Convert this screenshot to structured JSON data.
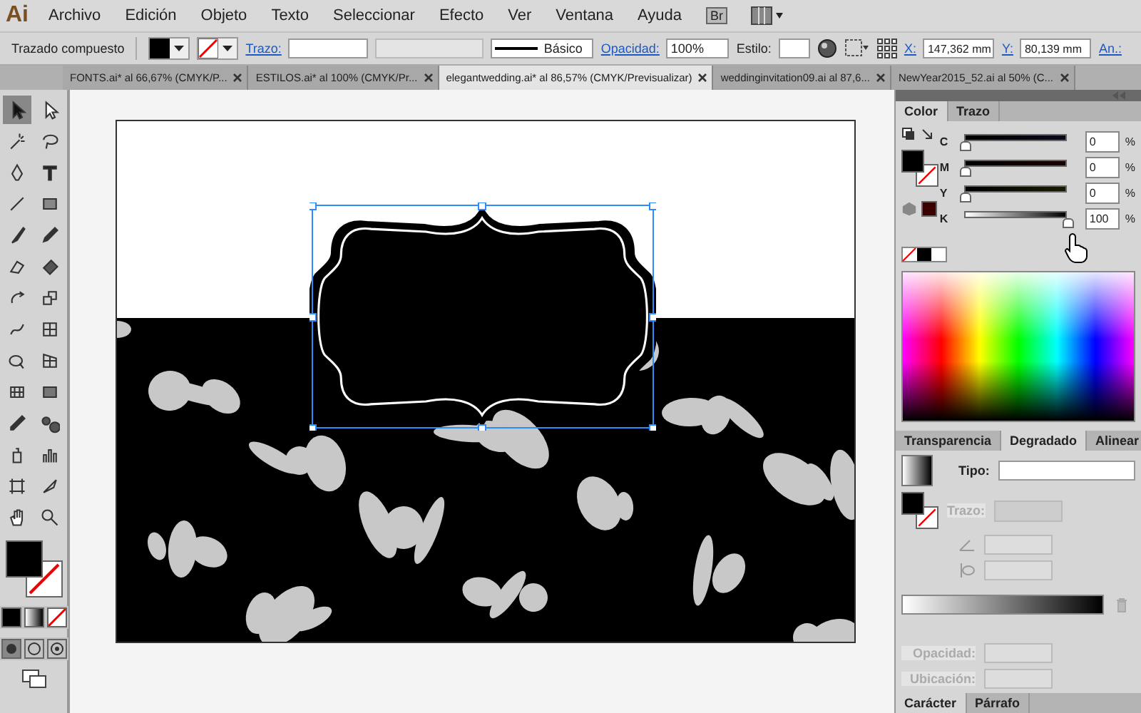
{
  "app_logo": "Ai",
  "menu": [
    "Archivo",
    "Edición",
    "Objeto",
    "Texto",
    "Seleccionar",
    "Efecto",
    "Ver",
    "Ventana",
    "Ayuda"
  ],
  "bridge_button": "Br",
  "control_bar": {
    "selection_label": "Trazado compuesto",
    "stroke_label": "Trazo:",
    "profile": "Básico",
    "opacity_label": "Opacidad:",
    "opacity": "100%",
    "style_label": "Estilo:",
    "x_label": "X:",
    "x": "147,362 mm",
    "y_label": "Y:",
    "y": "80,139 mm",
    "width_label": "An.:"
  },
  "document_tabs": [
    {
      "label": "FONTS.ai* al 66,67% (CMYK/P...",
      "selected": false
    },
    {
      "label": "ESTILOS.ai* al 100% (CMYK/Pr...",
      "selected": false
    },
    {
      "label": "elegantwedding.ai* al 86,57% (CMYK/Previsualizar)",
      "selected": true
    },
    {
      "label": "weddinginvitation09.ai al 87,6...",
      "selected": false
    },
    {
      "label": "NewYear2015_52.ai al 50% (C...",
      "selected": false
    }
  ],
  "tools": [
    {
      "selected": true
    },
    {
      "selected": false
    },
    {
      "selected": false
    },
    {
      "selected": false
    },
    {
      "selected": false
    },
    {
      "selected": false
    },
    {
      "selected": false
    },
    {
      "selected": false
    },
    {
      "selected": false
    },
    {
      "selected": false
    },
    {
      "selected": false
    },
    {
      "selected": false
    },
    {
      "selected": false
    },
    {
      "selected": false
    },
    {
      "selected": false
    },
    {
      "selected": false
    },
    {
      "selected": false
    },
    {
      "selected": false
    },
    {
      "selected": false
    },
    {
      "selected": false
    },
    {
      "selected": false
    },
    {
      "selected": false
    },
    {
      "selected": false
    },
    {
      "selected": false
    },
    {
      "selected": false
    },
    {
      "selected": false
    },
    {
      "selected": false
    },
    {
      "selected": false
    }
  ],
  "color_panel": {
    "tabs": [
      {
        "label": "Color",
        "selected": true
      },
      {
        "label": "Trazo",
        "selected": false
      }
    ],
    "sliders": [
      {
        "label": "C",
        "value": "0",
        "unit": "%",
        "level": 0
      },
      {
        "label": "M",
        "value": "0",
        "unit": "%",
        "level": 0
      },
      {
        "label": "Y",
        "value": "0",
        "unit": "%",
        "level": 0
      },
      {
        "label": "K",
        "value": "100",
        "unit": "%",
        "level": 1
      }
    ]
  },
  "gradient_panel": {
    "tabs": [
      {
        "label": "Transparencia",
        "selected": false
      },
      {
        "label": "Degradado",
        "selected": true
      },
      {
        "label": "Alinear",
        "selected": false
      }
    ],
    "type_label": "Tipo:",
    "stroke_label": "Trazo:",
    "opacity_label": "Opacidad:",
    "location_label": "Ubicación:"
  },
  "character_panel": {
    "tabs": [
      {
        "label": "Carácter",
        "selected": true
      },
      {
        "label": "Párrafo",
        "selected": false
      }
    ]
  }
}
